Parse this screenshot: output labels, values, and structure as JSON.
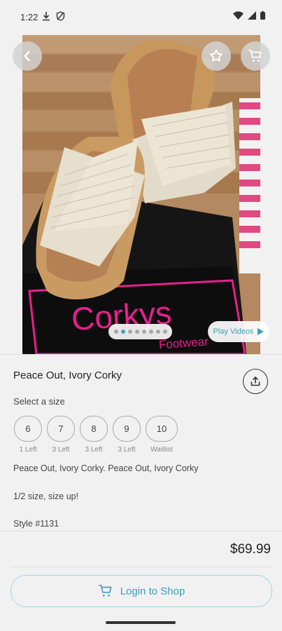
{
  "status": {
    "time": "1:22"
  },
  "hero": {
    "dots_count": 8,
    "active_dot": 1,
    "play_videos_label": "Play Videos",
    "box_logo_text": "Corkys",
    "box_logo_sub": "Footwear"
  },
  "product": {
    "title": "Peace Out, Ivory Corky",
    "select_size_label": "Select a size",
    "sizes": [
      {
        "label": "6",
        "stock": "1 Left"
      },
      {
        "label": "7",
        "stock": "3 Left"
      },
      {
        "label": "8",
        "stock": "3 Left"
      },
      {
        "label": "9",
        "stock": "3 Left"
      },
      {
        "label": "10",
        "stock": "Waitlist"
      }
    ],
    "description_line1": "Peace Out, Ivory Corky. Peace Out, Ivory Corky",
    "description_line2": "1/2 size, size up!",
    "style_number": "Style #1131",
    "price": "$69.99"
  },
  "actions": {
    "login_label": "Login to Shop"
  },
  "colors": {
    "accent": "#3fa6b8",
    "background": "#f1f1f1"
  }
}
